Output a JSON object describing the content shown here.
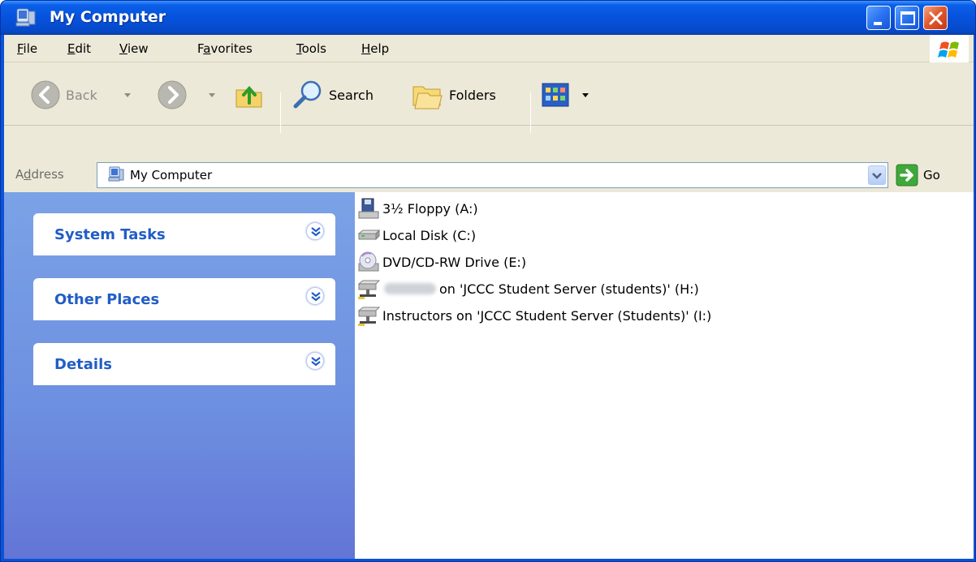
{
  "window": {
    "title": "My Computer",
    "icon": "my-computer-icon"
  },
  "menu": {
    "items": [
      {
        "label": "File",
        "accel": "F",
        "rest": "ile"
      },
      {
        "label": "Edit",
        "accel": "E",
        "rest": "dit"
      },
      {
        "label": "View",
        "accel": "V",
        "rest": "iew"
      },
      {
        "label": "Favorites",
        "accel": "a",
        "pre": "F",
        "rest": "vorites"
      },
      {
        "label": "Tools",
        "accel": "T",
        "rest": "ools"
      },
      {
        "label": "Help",
        "accel": "H",
        "rest": "elp"
      }
    ]
  },
  "toolbar": {
    "back_label": "Back",
    "search_label": "Search",
    "folders_label": "Folders"
  },
  "address": {
    "label": "Address",
    "value": "My Computer",
    "go_label": "Go"
  },
  "tasks": [
    {
      "title": "System Tasks"
    },
    {
      "title": "Other Places"
    },
    {
      "title": "Details"
    }
  ],
  "drives": [
    {
      "name": "3½ Floppy (A:)",
      "icon": "floppy-drive-icon"
    },
    {
      "name": "Local Disk (C:)",
      "icon": "hard-disk-icon"
    },
    {
      "name": "DVD/CD-RW Drive (E:)",
      "icon": "dvd-drive-icon"
    },
    {
      "name": "on 'JCCC Student Server (students)' (H:)",
      "icon": "network-drive-icon",
      "redacted_prefix": true
    },
    {
      "name": "Instructors on 'JCCC Student Server (Students)' (I:)",
      "icon": "network-drive-icon"
    }
  ],
  "colors": {
    "titlebar": "#0752dc",
    "taskpane": "#6d8fe0",
    "task_title": "#215dc6",
    "chrome": "#ece9d8"
  }
}
